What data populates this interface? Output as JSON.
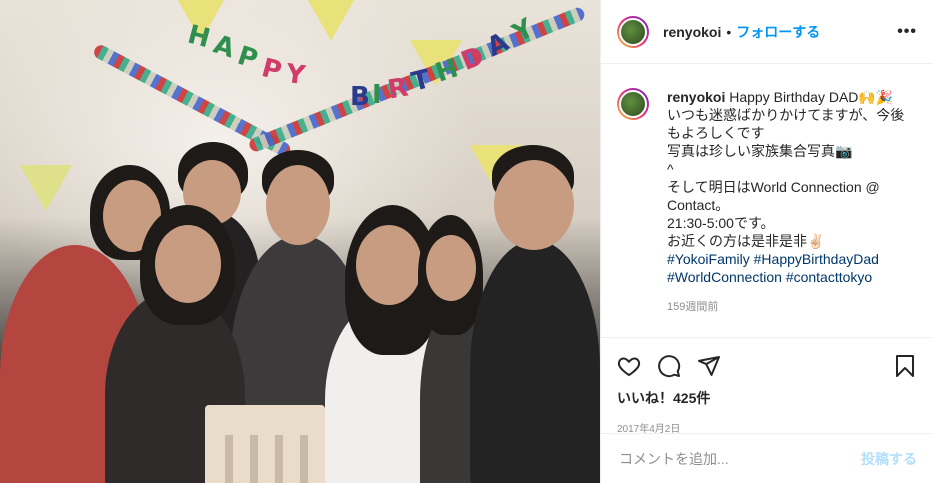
{
  "post": {
    "username": "renyokoi",
    "follow_label": "フォローする",
    "more_label": "•••",
    "caption": {
      "username": "renyokoi",
      "text": "Happy Birthday DAD🙌🎉\nいつも迷惑ばかりかけてますが、今後もよろしくです\n写真は珍しい家族集合写真📷\n^\nそして明日はWorld Connection @\nContact。\n21:30-5:00です。\nお近くの方は是非是非✌🏻",
      "hashtags": [
        "#YokoiFamily",
        "#HappyBirthdayDad",
        "#WorldConnection",
        "#contacttokyo"
      ],
      "time_ago": "159週間前"
    },
    "likes": "いいね！425件",
    "date": "2017年4月2日",
    "comment_placeholder": "コメントを追加...",
    "post_button": "投稿する",
    "icons": [
      "heart-icon",
      "comment-icon",
      "share-icon",
      "bookmark-icon",
      "more-icon"
    ]
  },
  "photo": {
    "banner_letters": [
      "H",
      "A",
      "P",
      "P",
      "Y",
      "B",
      "I",
      "R",
      "T",
      "H",
      "D",
      "A",
      "Y"
    ]
  },
  "colors": {
    "link": "#0095f6",
    "hashtag": "#00376b",
    "muted": "#8e8e8e",
    "post_disabled": "#b2dffc"
  }
}
